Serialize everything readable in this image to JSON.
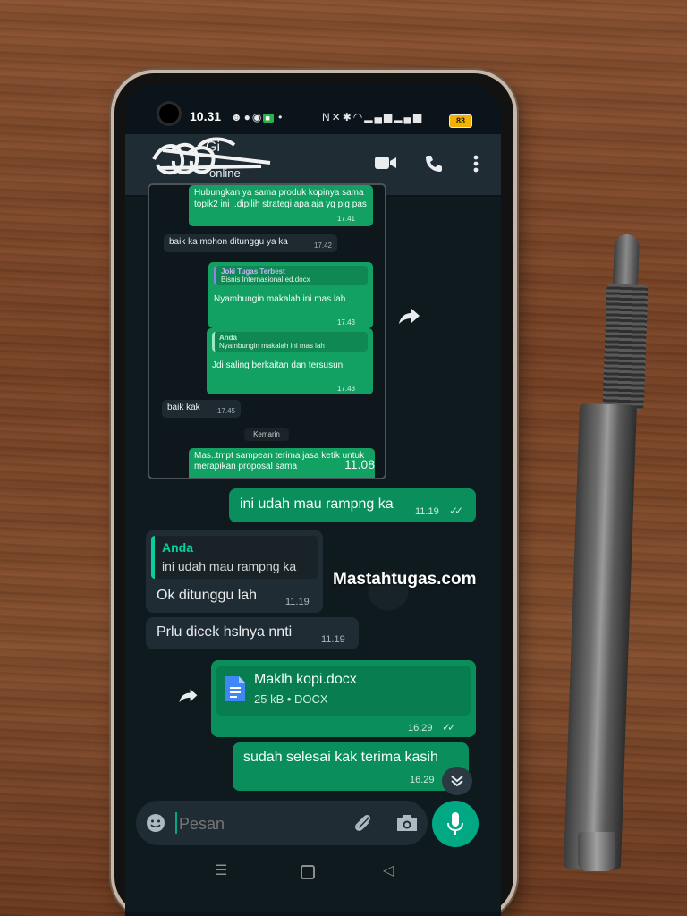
{
  "status_bar": {
    "time": "10.31",
    "battery": "83"
  },
  "chat_header": {
    "contact_name_redacted": "Gi",
    "status": "online"
  },
  "embedded_screenshot": {
    "messages": [
      {
        "type": "out",
        "text": "Hubungkan ya sama produk kopinya sama topik2 ini ..dipilih strategi apa aja yg plg pas",
        "time": "17.41"
      },
      {
        "type": "in",
        "text": "baik ka mohon ditunggu ya ka",
        "time": "17.42"
      },
      {
        "type": "out",
        "quote_author": "Joki Tugas Terbest",
        "quote_text": "Bisnis Internasional ed.docx",
        "text": "Nyambungin makalah ini mas lah",
        "time": "17.43"
      },
      {
        "type": "out",
        "quote_author": "Anda",
        "quote_text": "Nyambungin makalah ini mas lah",
        "text": "Jdi saling berkaitan dan tersusun",
        "time": "17.43"
      },
      {
        "type": "in",
        "text": "baik kak",
        "time": "17.45"
      },
      {
        "type": "date",
        "text": "Kemarin"
      },
      {
        "type": "out",
        "text": "Mas..tmpt sampean terima jasa ketik untuk merapikan proposal sama",
        "time": "11.08"
      }
    ]
  },
  "messages": {
    "m1": {
      "text": "ini udah mau rampng ka",
      "time": "11.19"
    },
    "m2": {
      "quote_author": "Anda",
      "quote_text": "ini udah mau rampng ka",
      "text": "Ok ditunggu lah",
      "time": "11.19"
    },
    "m3": {
      "text": "Prlu dicek hslnya nnti",
      "time": "11.19"
    },
    "m4": {
      "file_name": "Maklh kopi.docx",
      "file_meta": "25 kB • DOCX",
      "time": "16.29"
    },
    "m5": {
      "text": "sudah selesai kak terima kasih",
      "time": "16.29"
    }
  },
  "watermark": "Mastahtugas.com",
  "composer": {
    "placeholder": "Pesan"
  },
  "icons": {
    "header": [
      "video-call-icon",
      "voice-call-icon",
      "more-options-icon"
    ],
    "composer": [
      "emoji-icon",
      "attach-icon",
      "camera-icon",
      "mic-icon"
    ],
    "nav": [
      "recents-icon",
      "home-icon",
      "back-icon"
    ]
  },
  "colors": {
    "outgoing_bubble": "#0a8f5c",
    "incoming_bubble": "#202c33",
    "accent": "#00a884",
    "header": "#1f2c34"
  }
}
